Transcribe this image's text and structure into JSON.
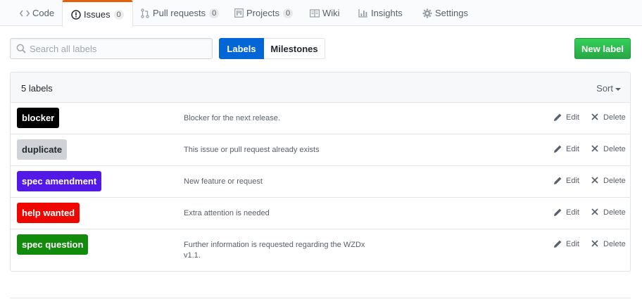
{
  "reponav": {
    "tabs": [
      {
        "label": "Code",
        "icon": "code-icon",
        "counter": null
      },
      {
        "label": "Issues",
        "icon": "issue-opened-icon",
        "counter": "0"
      },
      {
        "label": "Pull requests",
        "icon": "git-pull-request-icon",
        "counter": "0"
      },
      {
        "label": "Projects",
        "icon": "project-icon",
        "counter": "0"
      },
      {
        "label": "Wiki",
        "icon": "book-icon",
        "counter": null
      },
      {
        "label": "Insights",
        "icon": "graph-icon",
        "counter": null
      },
      {
        "label": "Settings",
        "icon": "gear-icon",
        "counter": null
      }
    ],
    "selected": "Issues",
    "accent_color": "#e36209"
  },
  "search": {
    "placeholder": "Search all labels",
    "value": ""
  },
  "subnav": {
    "labels": "Labels",
    "milestones": "Milestones",
    "selected": "Labels",
    "selected_color": "#0366d6"
  },
  "new_label_button": {
    "label": "New label",
    "color": "#28a745"
  },
  "labels_box": {
    "count_text": "5 labels",
    "sort_label": "Sort",
    "edit_label": "Edit",
    "delete_label": "Delete",
    "labels": [
      {
        "name": "blocker",
        "description": "Blocker for the next release.",
        "bg": "#000000",
        "fg": "#ffffff"
      },
      {
        "name": "duplicate",
        "description": "This issue or pull request already exists",
        "bg": "#cfd3d7",
        "fg": "#24292e"
      },
      {
        "name": "spec amendment",
        "description": "New feature or request",
        "bg": "#5319e7",
        "fg": "#ffffff"
      },
      {
        "name": "help wanted",
        "description": "Extra attention is needed",
        "bg": "#ee0701",
        "fg": "#ffffff"
      },
      {
        "name": "spec question",
        "description": "Further information is requested regarding the WZDx v1.1.",
        "bg": "#128a0c",
        "fg": "#ffffff"
      }
    ]
  }
}
